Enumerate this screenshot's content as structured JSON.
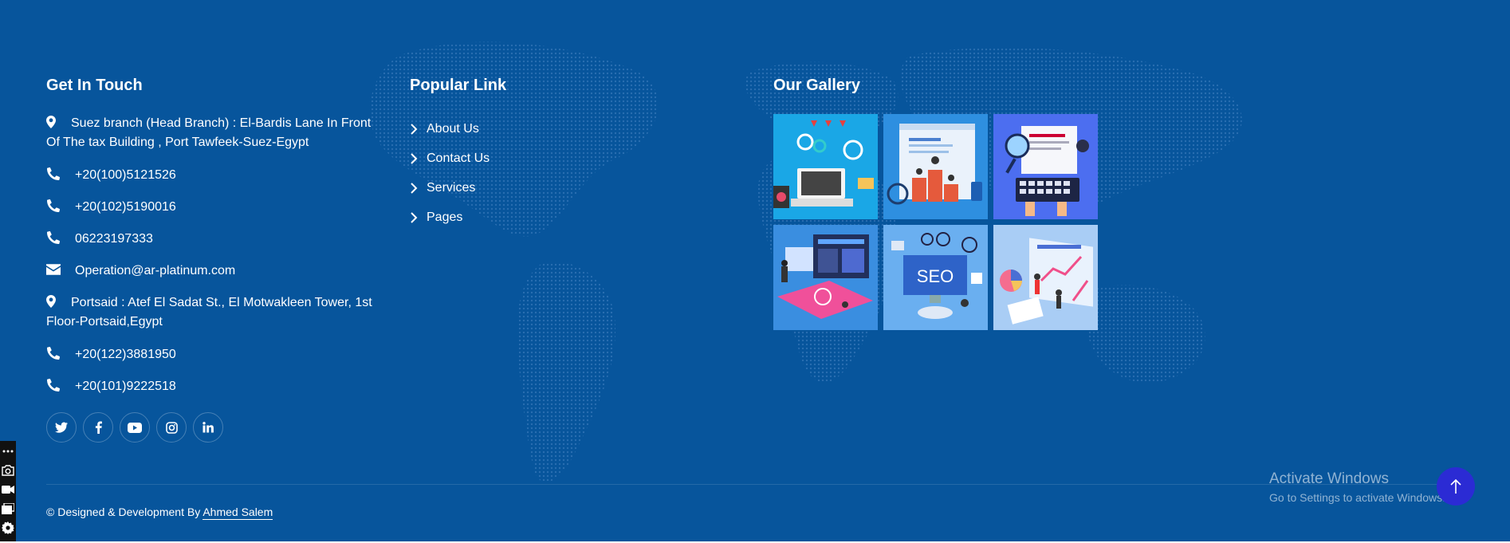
{
  "contact": {
    "heading": "Get In Touch",
    "items": [
      {
        "icon": "map-marker-icon",
        "text": "Suez branch (Head Branch) : El-Bardis Lane In Front Of The tax Building , Port Tawfeek-Suez-Egypt"
      },
      {
        "icon": "phone-icon",
        "text": "+20(100)5121526"
      },
      {
        "icon": "phone-icon",
        "text": "+20(102)5190016"
      },
      {
        "icon": "phone-icon",
        "text": "06223197333"
      },
      {
        "icon": "envelope-icon",
        "text": "Operation@ar-platinum.com"
      },
      {
        "icon": "map-marker-icon",
        "text": "Portsaid : Atef El Sadat St., El Motwakleen Tower, 1st Floor-Portsaid,Egypt"
      },
      {
        "icon": "phone-icon",
        "text": "+20(122)3881950"
      },
      {
        "icon": "phone-icon",
        "text": "+20(101)9222518"
      }
    ],
    "social": [
      "twitter-icon",
      "facebook-icon",
      "youtube-icon",
      "instagram-icon",
      "linkedin-icon"
    ]
  },
  "links": {
    "heading": "Popular Link",
    "items": [
      "About Us",
      "Contact Us",
      "Services",
      "Pages"
    ]
  },
  "gallery": {
    "heading": "Our Gallery",
    "images": [
      "laptop-analytics-illustration",
      "seo-ranking-podium-illustration",
      "keyboard-document-search-illustration",
      "dashboard-workspace-illustration",
      "seo-monitor-illustration",
      "chart-analytics-illustration"
    ]
  },
  "footer": {
    "copyright_prefix": "© Designed & Development By",
    "author": "Ahmed Salem"
  },
  "overlay": {
    "activate_title": "Activate Windows",
    "activate_sub": "Go to Settings to activate Windows."
  },
  "colors": {
    "background": "#07559c",
    "scroll_top_button": "#2b2bd4"
  }
}
